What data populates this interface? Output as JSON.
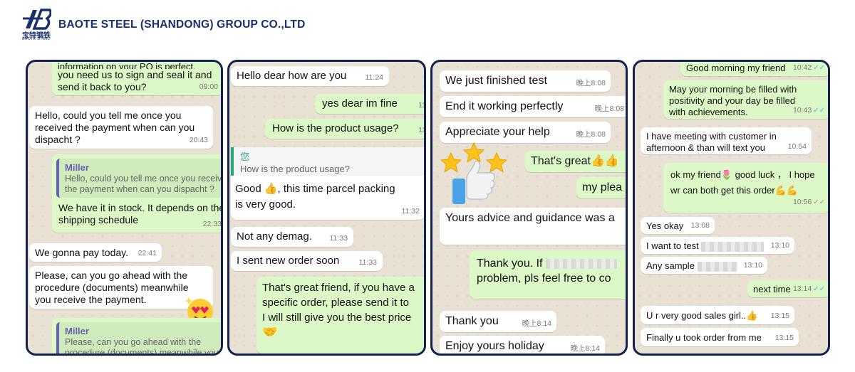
{
  "header": {
    "logo_cn": "宝特钢铁",
    "logo_en": "BAOTE STEEL",
    "company": "BAOTE STEEL (SHANDONG) GROUP CO.,LTD"
  },
  "panel1": {
    "m1": {
      "text1": "information on your PO is perfect.",
      "text2": "you need us to sign and seal it and",
      "text3": "send it back to you?",
      "time": "09:00"
    },
    "m2": {
      "text1": "Hello, could you tell me once you",
      "text2": "received the payment when can you",
      "text3": "dispacht ?",
      "time": "20:43"
    },
    "m3": {
      "qname": "Miller",
      "qtext1": "Hello, could you tell me once you received",
      "qtext2": "the payment when can you dispacht ?",
      "text1": "We have it in stock. It depends on the",
      "text2": "shipping schedule",
      "time": "22:33"
    },
    "m4": {
      "text": "We gonna pay today.",
      "time": "22:41"
    },
    "m5": {
      "text1": "Please, can you go ahead with the",
      "text2": "procedure (documents) meanwhile",
      "text3": "you receive the payment."
    },
    "m6": {
      "qname": "Miller",
      "qtext1": "Please, can you go ahead with the",
      "qtext2": "procedure (documents) meanwhile you"
    }
  },
  "panel2": {
    "m1": {
      "text": "Hello dear how are you",
      "time": "11:24"
    },
    "m2": {
      "text": "yes  dear  im fine",
      "time": "11"
    },
    "m3": {
      "text": "How is the product usage?",
      "time": "11"
    },
    "m4": {
      "qname": "您",
      "qtext": "How is the product usage?",
      "text1": "Good 👍, this time parcel packing",
      "text2": "is very good.",
      "time": "11:32"
    },
    "m5": {
      "text": "Not any demag.",
      "time": "11:33"
    },
    "m6": {
      "text": "I sent new order soon",
      "time": "11:33"
    },
    "m7": {
      "text1": "That's great friend, if you have a",
      "text2": "specific order, please send it to",
      "text3": "I will still give you the best price",
      "emoji": "🤝",
      "time": "11"
    }
  },
  "panel3": {
    "m1": {
      "text": "We just finished test",
      "time": "晚上8:08"
    },
    "m2": {
      "text": "End it working perfectly",
      "time": "晚上8:08"
    },
    "m3": {
      "text": "Appreciate your help",
      "time": "晚上8:08"
    },
    "m4": {
      "text": "That's great👍👍"
    },
    "m5": {
      "text": "my plea"
    },
    "m6": {
      "text": "Yours advice and guidance was a"
    },
    "m7": {
      "text1": "Thank you. If",
      "text2": "problem, pls feel free to co"
    },
    "m8": {
      "text": "Thank you",
      "time": "晚上8:14"
    },
    "m9": {
      "text": "Enjoy yours holiday",
      "time": "晚上8:14"
    },
    "sticker": {
      "stars": "★ ★ ★",
      "thumb": "👍"
    }
  },
  "panel4": {
    "m1": {
      "text": "Good morning my friend",
      "time": "10:42"
    },
    "m2": {
      "text1": "May your morning be filled with",
      "text2": "positivity and your day be filled",
      "text3": "with achievements.",
      "time": "10:43"
    },
    "m3": {
      "text1": "I have meeting with customer in",
      "text2": "afternoon & than will text you",
      "time": "10:54"
    },
    "m4": {
      "text1": "ok my friend🌷 good luck ， I hope",
      "text2": "wr can both get this order💪💪",
      "time": "10:56"
    },
    "m5": {
      "text": "Yes okay",
      "time": "13:08"
    },
    "m6": {
      "text": "I want to test",
      "time": "13:10"
    },
    "m7": {
      "text": "Any sample",
      "time": "13:10"
    },
    "m8": {
      "text": "next time",
      "time": "13:14"
    },
    "m9": {
      "text": "U r very good sales girl..👍",
      "time": "13:15"
    },
    "m10": {
      "text": "Finally u took order from me",
      "time": "13:15"
    },
    "tick": "✓✓"
  },
  "colors": {
    "navy": "#13224f",
    "incoming": "#ffffff",
    "outgoing": "#dcf8c6",
    "quote": "#6a5fb5",
    "chat_bg": "#e9e1d3"
  }
}
